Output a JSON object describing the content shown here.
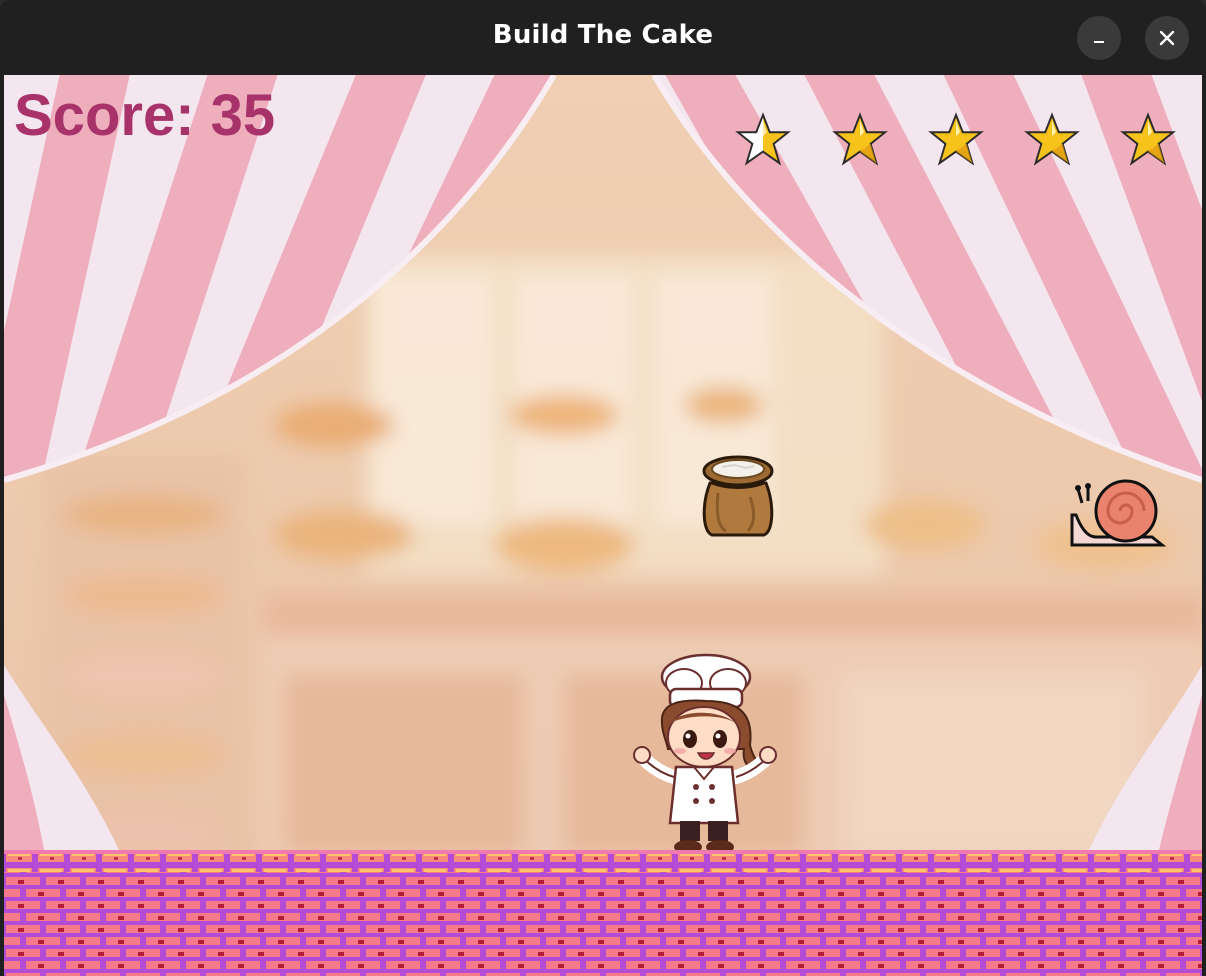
{
  "window": {
    "title": "Build The Cake",
    "minimize_icon": "minimize-icon",
    "close_icon": "close-icon"
  },
  "hud": {
    "score_label": "Score:",
    "score_value": 35,
    "score_text": "Score: 35",
    "lives_total": 5,
    "lives_remaining": 4,
    "star_icon": "star-icon"
  },
  "sprites": {
    "falling_item_1": "flour-sack-icon",
    "falling_item_2": "snail-icon",
    "player": "chef-girl-character"
  },
  "colors": {
    "score_text": "#a8326a",
    "star_gold": "#f6c21c",
    "curtain_pink": "#eeb0bd",
    "curtain_white": "#f4e6ee",
    "floor_purple": "#b34bd6",
    "floor_brick": "#f57a8a"
  }
}
